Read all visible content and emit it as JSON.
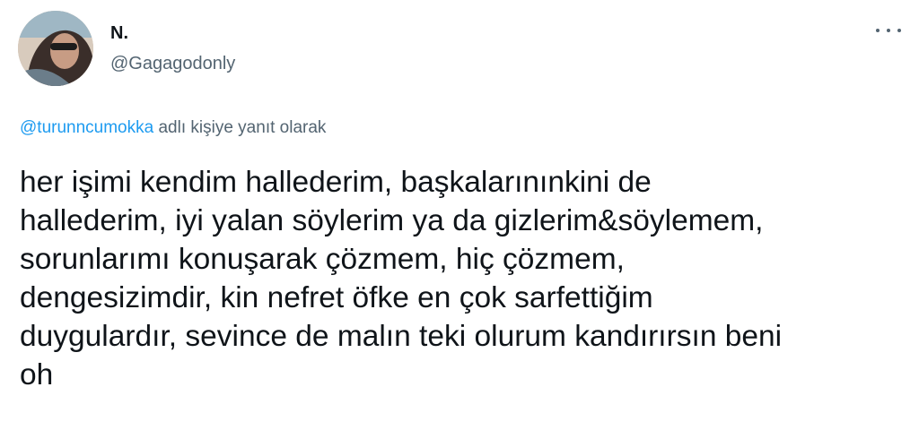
{
  "author": {
    "display_name": "N.",
    "handle": "@Gagagodonly"
  },
  "reply_context": {
    "mention": "@turunncumokka",
    "suffix": "adlı kişiye yanıt olarak"
  },
  "tweet": {
    "lines": [
      "her işimi kendim hallederim, başkalarınınkini de",
      "hallederim, iyi yalan söylerim ya da gizlerim&söylemem,",
      "sorunlarımı konuşarak çözmem, hiç çözmem,",
      "dengesizimdir, kin nefret öfke en çok sarfettiğim",
      "duygulardır, sevince de malın teki olurum kandırırsın beni",
      "oh"
    ]
  },
  "icons": {
    "more": "more-horizontal-icon"
  },
  "colors": {
    "text": "#0f1419",
    "secondary": "#536471",
    "link": "#1d9bf0"
  }
}
